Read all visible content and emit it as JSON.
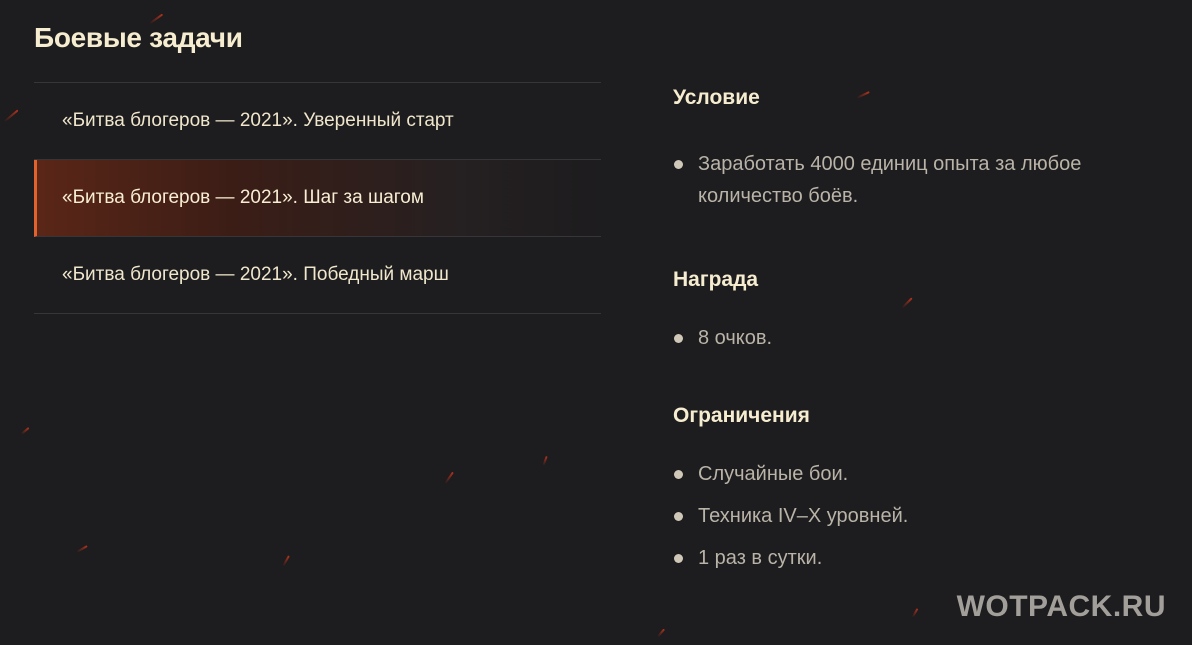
{
  "page": {
    "title": "Боевые задачи"
  },
  "missions": [
    {
      "label": "«Битва блогеров — 2021». Уверенный старт",
      "active": false
    },
    {
      "label": "«Битва блогеров — 2021». Шаг за шагом",
      "active": true
    },
    {
      "label": "«Битва блогеров — 2021». Победный марш",
      "active": false
    }
  ],
  "details": {
    "condition": {
      "title": "Условие",
      "items": [
        "Заработать 4000 единиц опыта за любое количество боёв."
      ]
    },
    "reward": {
      "title": "Награда",
      "items": [
        "8 очков."
      ]
    },
    "limits": {
      "title": "Ограничения",
      "items": [
        "Случайные бои.",
        "Техника IV–X уровней.",
        "1 раз в сутки."
      ]
    }
  },
  "watermark": "WOTPACK.RU",
  "colors": {
    "background": "#1d1c1e",
    "accent": "#e0622e",
    "text": "#f3ead3",
    "muted": "#b9b3a8"
  }
}
